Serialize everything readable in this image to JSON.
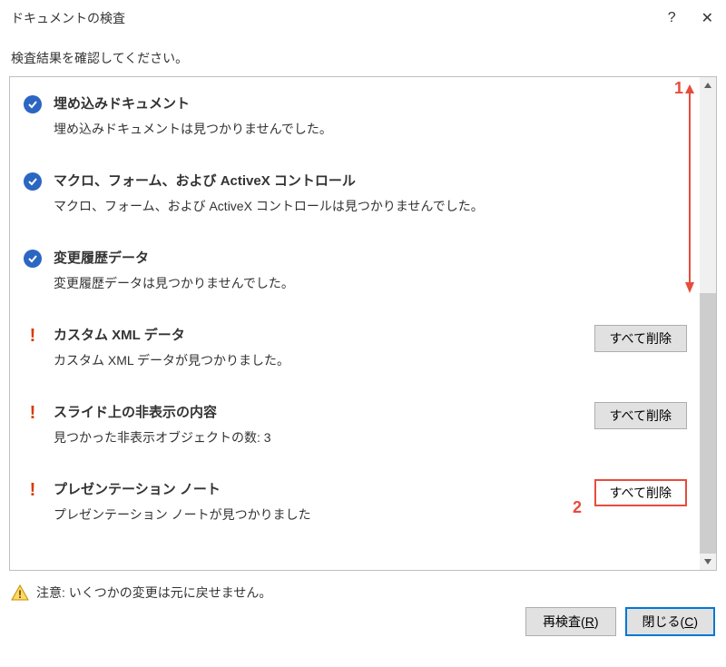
{
  "title": "ドキュメントの検査",
  "subtitle": "検査結果を確認してください。",
  "items": [
    {
      "status": "ok",
      "title": "埋め込みドキュメント",
      "desc": "埋め込みドキュメントは見つかりませんでした。",
      "remove": null
    },
    {
      "status": "ok",
      "title": "マクロ、フォーム、および ActiveX コントロール",
      "desc": "マクロ、フォーム、および ActiveX コントロールは見つかりませんでした。",
      "remove": null
    },
    {
      "status": "ok",
      "title": "変更履歴データ",
      "desc": "変更履歴データは見つかりませんでした。",
      "remove": null
    },
    {
      "status": "warn",
      "title": "カスタム XML データ",
      "desc": "カスタム XML データが見つかりました。",
      "remove": "すべて削除"
    },
    {
      "status": "warn",
      "title": "スライド上の非表示の内容",
      "desc": "見つかった非表示オブジェクトの数: 3",
      "remove": "すべて削除"
    },
    {
      "status": "warn",
      "title": "プレゼンテーション ノート",
      "desc": "プレゼンテーション ノートが見つかりました",
      "remove": "すべて削除",
      "highlighted": true
    }
  ],
  "footer_note": "注意: いくつかの変更は元に戻せません。",
  "reinspect_label": "再検査(R)",
  "close_label": "閉じる(C)",
  "annotations": {
    "one": "1",
    "two": "2"
  }
}
